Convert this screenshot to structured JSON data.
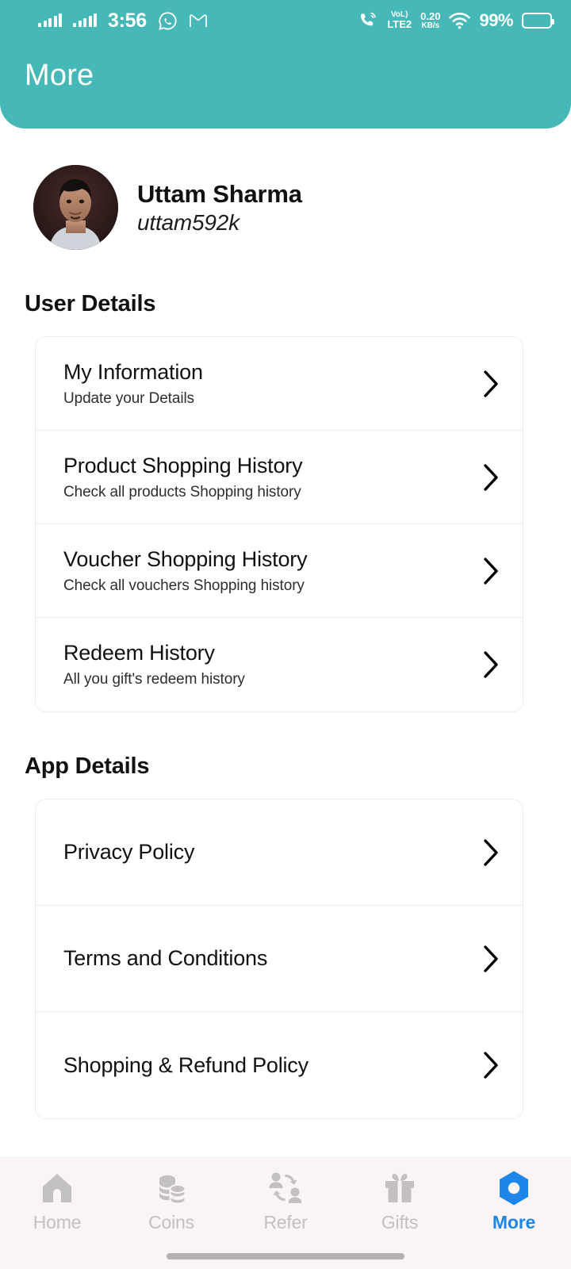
{
  "statusbar": {
    "time": "3:56",
    "signal_icon_1": "signal-bars-icon",
    "signal_icon_2": "signal-bars-icon",
    "whatsapp_icon": "whatsapp-icon",
    "gmail_icon": "gmail-icon",
    "volte_call_icon": "volte-call-icon",
    "volte_line1": "VoL)",
    "volte_line2": "LTE2",
    "netspeed_value": "0.20",
    "netspeed_unit": "KB/s",
    "wifi_icon": "wifi-icon",
    "battery_percent": "99%",
    "battery_icon": "battery-icon"
  },
  "header": {
    "title": "More",
    "background_color": "#46b8b8"
  },
  "profile": {
    "avatar": "user-avatar-photo",
    "name": "Uttam Sharma",
    "handle": "uttam592k"
  },
  "sections": [
    {
      "title": "User Details",
      "rows": [
        {
          "title": "My Information",
          "sub": "Update your Details",
          "chevron": "chevron-right-icon"
        },
        {
          "title": "Product Shopping History",
          "sub": "Check all products Shopping history",
          "chevron": "chevron-right-icon"
        },
        {
          "title": "Voucher Shopping History",
          "sub": "Check all vouchers Shopping history",
          "chevron": "chevron-right-icon"
        },
        {
          "title": "Redeem History",
          "sub": "All you gift's redeem history",
          "chevron": "chevron-right-icon"
        }
      ]
    },
    {
      "title": "App Details",
      "rows": [
        {
          "title": "Privacy Policy",
          "sub": "",
          "chevron": "chevron-right-icon"
        },
        {
          "title": "Terms and Conditions",
          "sub": "",
          "chevron": "chevron-right-icon"
        },
        {
          "title": "Shopping & Refund Policy",
          "sub": "",
          "chevron": "chevron-right-icon"
        }
      ]
    }
  ],
  "bottomnav": {
    "active_color": "#1d86e8",
    "inactive_color": "#c3c0c0",
    "items": [
      {
        "label": "Home",
        "icon": "home-icon",
        "active": false
      },
      {
        "label": "Coins",
        "icon": "coins-icon",
        "active": false
      },
      {
        "label": "Refer",
        "icon": "refer-icon",
        "active": false
      },
      {
        "label": "Gifts",
        "icon": "gift-icon",
        "active": false
      },
      {
        "label": "More",
        "icon": "hexagon-more-icon",
        "active": true
      }
    ]
  }
}
